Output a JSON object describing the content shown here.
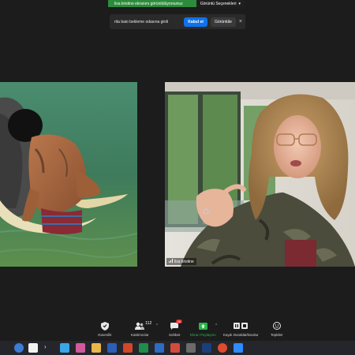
{
  "share_banner": {
    "message": "lisa kristine ekranını görüntülüyorsunuz",
    "view_options": "Görüntü Seçenekleri"
  },
  "waiting_room": {
    "message": "rita baio bekleme odasına girdi",
    "admit_label": "Kabul et",
    "view_label": "Görüntüle"
  },
  "participants": {
    "right_name": "lisa kristine"
  },
  "toolbar": {
    "security": "Güvenlik",
    "participants_label": "Katılımcılar",
    "participants_count": "112",
    "chat": "Sohbet",
    "chat_badge": "26",
    "share": "Ekran Paylaşımı",
    "record": "Kaydı Duraklat/Durdur",
    "reactions": "Tepkiler"
  },
  "colors": {
    "share_green": "#2d8c3c",
    "admit_blue": "#0e72ed",
    "chat_badge_red": "#e02828",
    "toolbar_bg": "#1c1c1c"
  }
}
